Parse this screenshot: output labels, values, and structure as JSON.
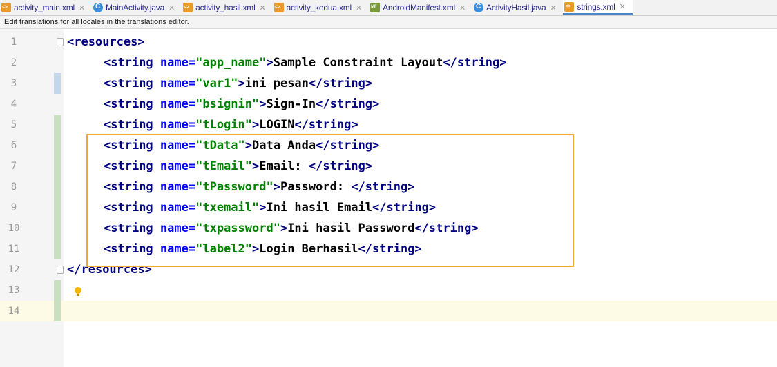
{
  "tabs": [
    {
      "label": "activity_main.xml",
      "icon": "xml-file-icon",
      "active": false
    },
    {
      "label": "MainActivity.java",
      "icon": "java-class-icon",
      "active": false
    },
    {
      "label": "activity_hasil.xml",
      "icon": "xml-file-icon",
      "active": false
    },
    {
      "label": "activity_kedua.xml",
      "icon": "xml-file-icon",
      "active": false
    },
    {
      "label": "AndroidManifest.xml",
      "icon": "manifest-file-icon",
      "active": false
    },
    {
      "label": "ActivityHasil.java",
      "icon": "java-class-icon",
      "active": false
    },
    {
      "label": "strings.xml",
      "icon": "xml-file-icon",
      "active": true
    }
  ],
  "banner": {
    "text": "Edit translations for all locales in the translations editor."
  },
  "editor": {
    "lines": [
      {
        "num": "1",
        "open": "<",
        "tag": "resources",
        "close": ">"
      },
      {
        "num": "2",
        "name": "\"app_name\"",
        "value": "Sample Constraint Layout"
      },
      {
        "num": "3",
        "name": "\"var1\"",
        "value": "ini pesan"
      },
      {
        "num": "4",
        "name": "\"bsignin\"",
        "value": "Sign-In"
      },
      {
        "num": "5",
        "name": "\"tLogin\"",
        "value": "LOGIN"
      },
      {
        "num": "6",
        "name": "\"tData\"",
        "value": "Data Anda"
      },
      {
        "num": "7",
        "name": "\"tEmail\"",
        "value": "Email: "
      },
      {
        "num": "8",
        "name": "\"tPassword\"",
        "value": "Password: "
      },
      {
        "num": "9",
        "name": "\"txemail\"",
        "value": "Ini hasil Email"
      },
      {
        "num": "10",
        "name": "\"txpassword\"",
        "value": "Ini hasil Password"
      },
      {
        "num": "11",
        "name": "\"label2\"",
        "value": "Login Berhasil"
      },
      {
        "num": "12",
        "open": "</",
        "tag": "resources",
        "close": ">"
      },
      {
        "num": "13"
      },
      {
        "num": "14"
      }
    ],
    "string_tag": "string",
    "name_attr": "name=",
    "accent": "#f0a830"
  }
}
